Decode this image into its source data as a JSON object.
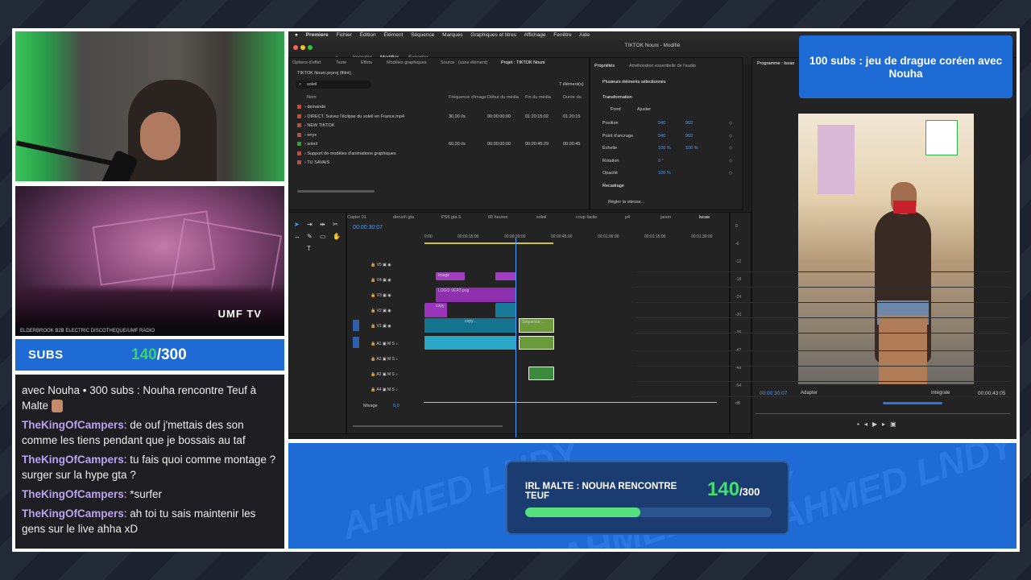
{
  "overlay": {
    "subs_label": "SUBS",
    "subs_current": "140",
    "subs_total": "/300",
    "goal_text": "100 subs : jeu de drague coréen avec Nouha",
    "banner_title": "IRL MALTE : NOUHA RENCONTRE TEUF",
    "banner_current": "140",
    "banner_total": "/300",
    "banner_progress": 0.4667,
    "watermark": "AHMED LNDY",
    "colors": {
      "accent": "#1f6bd6",
      "green": "#39d26b"
    }
  },
  "concert": {
    "ticker": "ELDERBROOK B2B ELECTRIC DISCOTHEQUE/UMF RADIO",
    "logo": "UMF TV"
  },
  "chat": [
    {
      "user": "",
      "text": "avec Nouha • 300 subs : Nouha rencontre Teuf à Malte",
      "emote": true
    },
    {
      "user": "TheKingOfCampers",
      "text": ": de ouf j'mettais des son comme les tiens pendant que je bossais au taf"
    },
    {
      "user": "TheKingOfCampers",
      "text": ": tu fais quoi comme montage ? surger sur la hype gta ?"
    },
    {
      "user": "TheKingOfCampers",
      "text": ": *surfer"
    },
    {
      "user": "TheKingOfCampers",
      "text": ": ah toi tu sais maintenir les gens sur le live ahha xD"
    }
  ],
  "premiere": {
    "menu": [
      "Premiere",
      "Fichier",
      "Édition",
      "Élément",
      "Séquence",
      "Marques",
      "Graphiques et titres",
      "Affichage",
      "Fenêtre",
      "Aide"
    ],
    "window_title": "TIKTOK Nouni - Modifié",
    "workspace_tabs": [
      "Importer",
      "Modifier",
      "Exporter"
    ],
    "left_tabs": [
      "Options d'effet",
      "Texte",
      "Effets",
      "Modèles graphiques",
      "Source : (sans élément)",
      "Projet : TIKTOK Nouni"
    ],
    "project_name": "TIKTOK Nouni.prproj (filtré)",
    "search_value": "soleil",
    "items_count": "7 élément(s)",
    "columns": [
      "Nom",
      "Fréquence d'image",
      "Début du média",
      "Fin du média",
      "Durée du"
    ],
    "files": [
      {
        "name": "demande",
        "fps": "",
        "start": "",
        "end": "",
        "dur": "",
        "color": "#c64a3a"
      },
      {
        "name": "DIRECT. Suivez l'éclipse du soleil en France.mp4",
        "fps": "30,00 i/s",
        "start": "00:00:00:00",
        "end": "01:20:15:02",
        "dur": "01:20:15",
        "color": "#c64a3a"
      },
      {
        "name": "NEW TIKTOK",
        "fps": "",
        "start": "",
        "end": "",
        "dur": "",
        "color": "#c64a3a"
      },
      {
        "name": "onyx",
        "fps": "",
        "start": "",
        "end": "",
        "dur": "",
        "color": "#c64a3a"
      },
      {
        "name": "soleil",
        "fps": "60,00 i/s",
        "start": "00:00:00:00",
        "end": "00:00:45:29",
        "dur": "00:00:45",
        "color": "#3c9a3c"
      },
      {
        "name": "Support de modèles d'animations graphiques",
        "fps": "",
        "start": "",
        "end": "",
        "dur": "",
        "color": "#c64a3a"
      },
      {
        "name": "TU SAVAIS",
        "fps": "",
        "start": "",
        "end": "",
        "dur": "",
        "color": "#c64a3a"
      }
    ],
    "props_tabs": [
      "Propriétés",
      "Amélioration essentielle de l'audio"
    ],
    "props_title": "Plusieurs éléments sélectionnés",
    "transform_label": "Transformation",
    "fit_labels": [
      "Fond",
      "Ajuster"
    ],
    "props": [
      {
        "label": "Position",
        "v1": "540",
        "v2": "960"
      },
      {
        "label": "Point d'ancrage",
        "v1": "540",
        "v2": "960"
      },
      {
        "label": "Échelle",
        "v1": "100 %",
        "v2": "100 %"
      },
      {
        "label": "Rotation",
        "v1": "0 °",
        "v2": ""
      },
      {
        "label": "Opacité",
        "v1": "100 %",
        "v2": ""
      }
    ],
    "recadrage": "Recadrage",
    "speed": "Régler la vitesse...",
    "program_label": "Programme : lucas",
    "sequence_tabs": [
      "Copier 01",
      "derush gta",
      "PS5 gta 6",
      "60 heures",
      "soleil",
      "coup facile",
      "p4",
      "jason",
      "lucas"
    ],
    "timecode": "00:00:30:07",
    "ruler": [
      "0:00",
      "00:00:15:00",
      "00:00:30:00",
      "00:00:45:00",
      "00:01:00:00",
      "00:01:15:00",
      "00:01:30:00"
    ],
    "video_tracks": [
      "V5",
      "V4",
      "V3",
      "V2",
      "V1"
    ],
    "audio_tracks": [
      "A1",
      "A2",
      "A3",
      "A4"
    ],
    "mix_label": "Mixage",
    "mix_value": "0,0",
    "clips": [
      "Image",
      "LOGO VERT.png",
      "copy",
      "copy...",
      "Séquence ..."
    ],
    "prog_timecode": "00:00:30:07",
    "prog_fit": "Adapter",
    "prog_quality": "Intégrale",
    "prog_duration": "00:00:43:05",
    "meter_ticks": [
      "0",
      "-6",
      "-12",
      "-18",
      "-24",
      "-30",
      "-36",
      "-42",
      "-48",
      "-54",
      "dB"
    ]
  }
}
